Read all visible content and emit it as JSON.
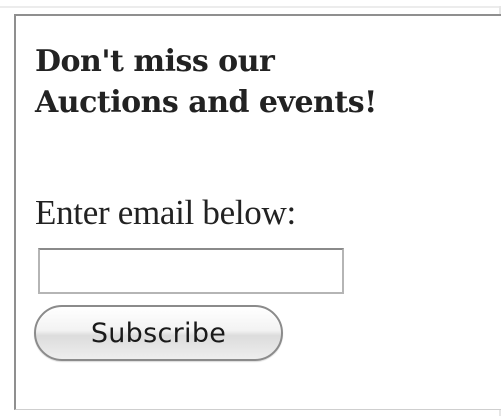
{
  "signup": {
    "heading_line1": "Don't miss our",
    "heading_line2": "Auctions and events!",
    "prompt": "Enter email below:",
    "email_value": "",
    "subscribe_label": "Subscribe"
  }
}
